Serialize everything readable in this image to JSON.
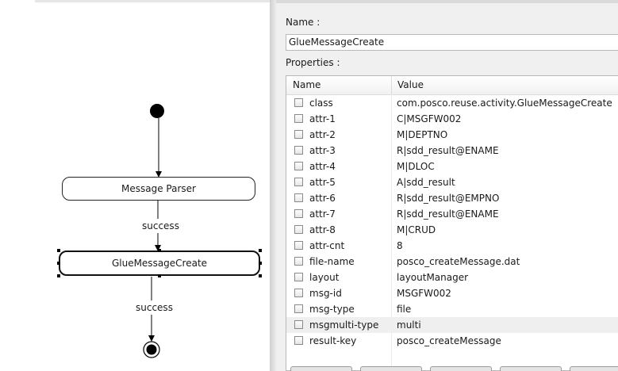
{
  "diagram": {
    "nodes": {
      "message_parser": "Message Parser",
      "glue_message_create": "GlueMessageCreate"
    },
    "edges": {
      "edge1": "success",
      "edge2": "success"
    }
  },
  "panel": {
    "name_label": "Name :",
    "name_value": "GlueMessageCreate",
    "properties_label": "Properties :",
    "columns": {
      "name": "Name",
      "value": "Value"
    },
    "rows": [
      {
        "name": "class",
        "value": "com.posco.reuse.activity.GlueMessageCreate"
      },
      {
        "name": "attr-1",
        "value": "C|MSGFW002"
      },
      {
        "name": "attr-2",
        "value": "M|DEPTNO"
      },
      {
        "name": "attr-3",
        "value": "R|sdd_result@ENAME"
      },
      {
        "name": "attr-4",
        "value": "M|DLOC"
      },
      {
        "name": "attr-5",
        "value": "A|sdd_result"
      },
      {
        "name": "attr-6",
        "value": "R|sdd_result@EMPNO"
      },
      {
        "name": "attr-7",
        "value": "R|sdd_result@ENAME"
      },
      {
        "name": "attr-8",
        "value": "M|CRUD"
      },
      {
        "name": "attr-cnt",
        "value": "8"
      },
      {
        "name": "file-name",
        "value": "posco_createMessage.dat"
      },
      {
        "name": "layout",
        "value": "layoutManager"
      },
      {
        "name": "msg-id",
        "value": "MSGFW002"
      },
      {
        "name": "msg-type",
        "value": "file"
      },
      {
        "name": "msgmulti-type",
        "value": "multi"
      },
      {
        "name": "result-key",
        "value": "posco_createMessage"
      }
    ]
  }
}
